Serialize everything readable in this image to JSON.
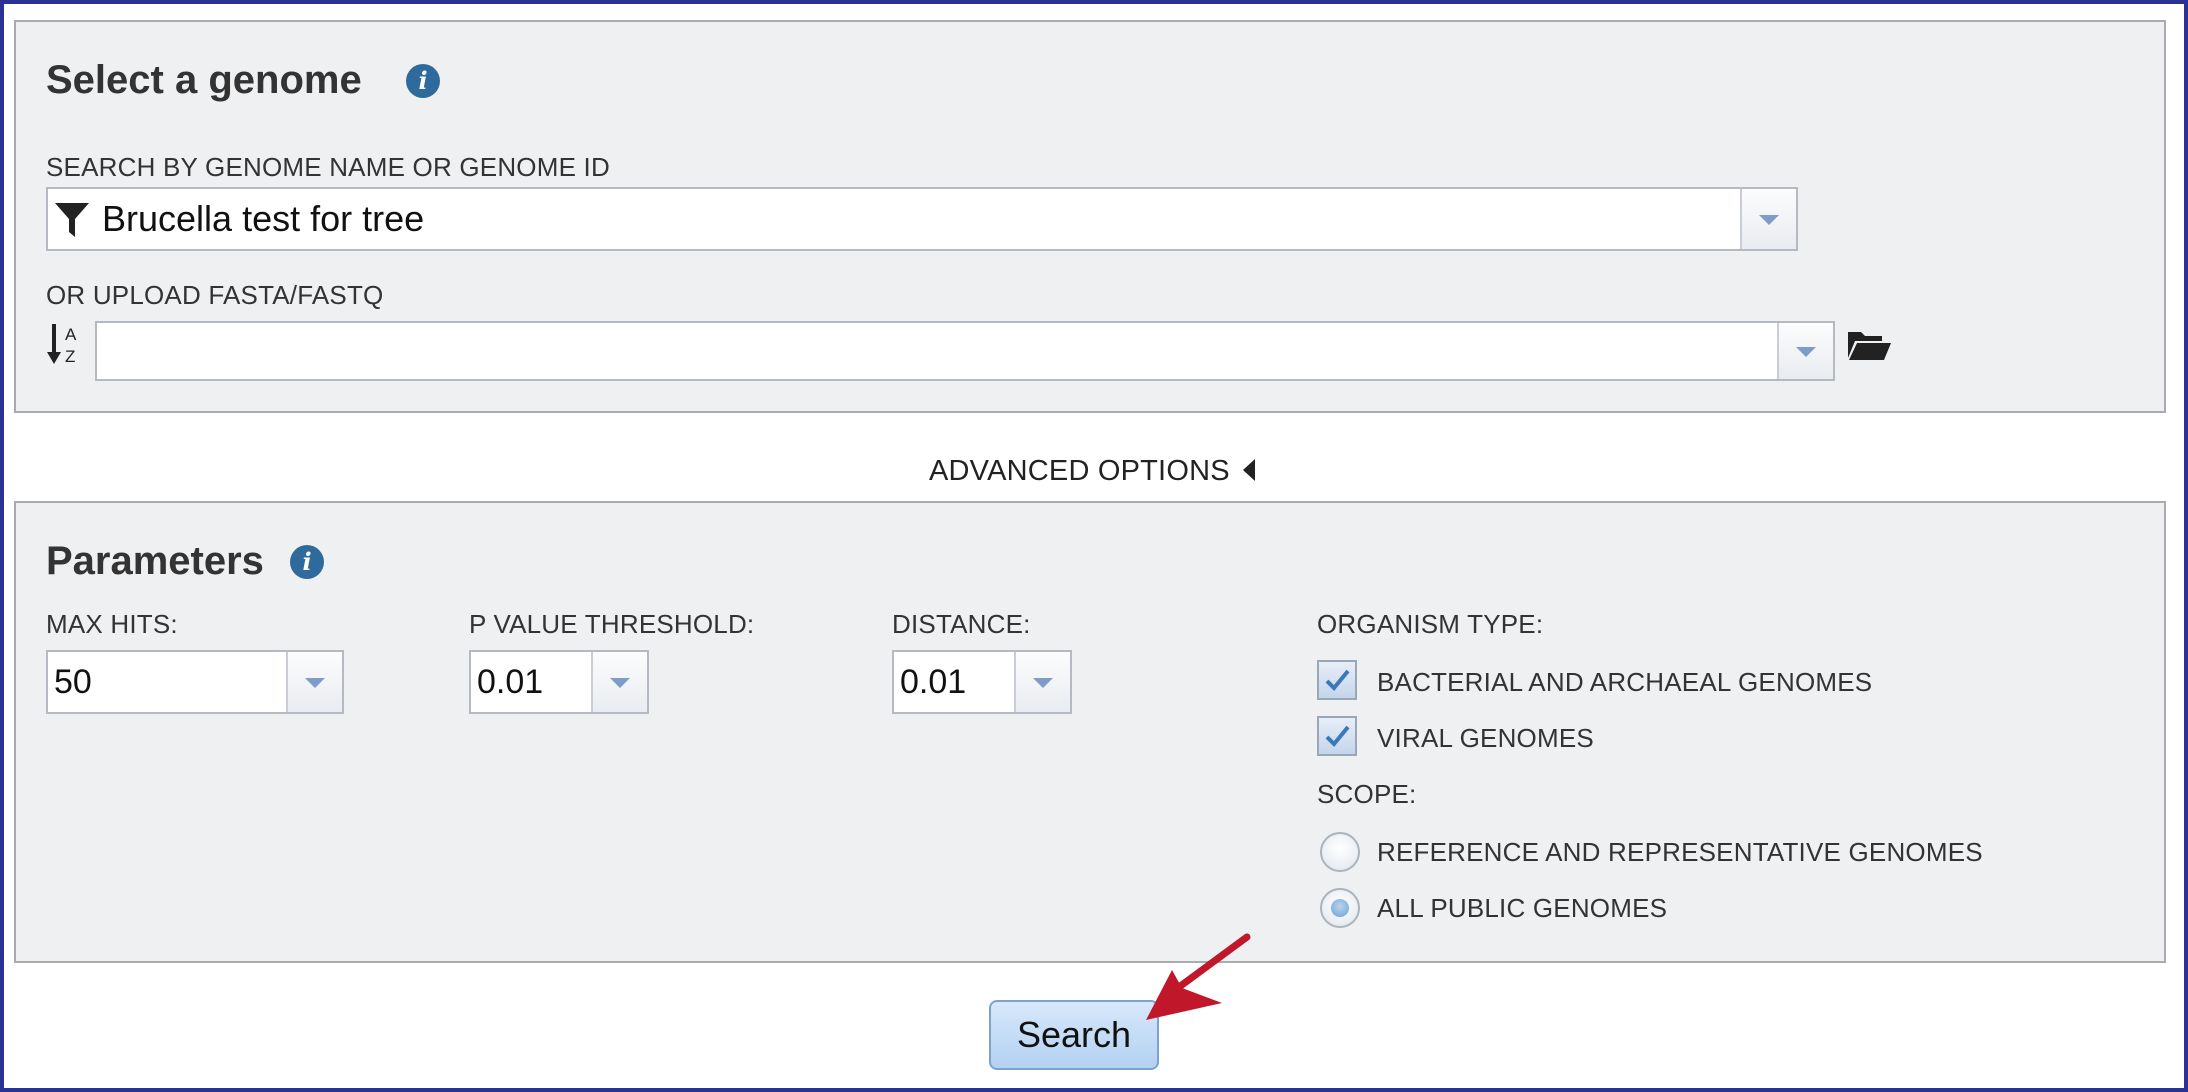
{
  "select_genome": {
    "heading": "Select a genome",
    "search_label": "SEARCH BY GENOME NAME OR GENOME ID",
    "search_value": "Brucella test for tree",
    "upload_label": "OR UPLOAD FASTA/FASTQ",
    "upload_value": ""
  },
  "advanced_options": {
    "label": "ADVANCED OPTIONS"
  },
  "parameters": {
    "heading": "Parameters",
    "max_hits": {
      "label": "MAX HITS:",
      "value": "50"
    },
    "p_value": {
      "label": "P VALUE THRESHOLD:",
      "value": "0.01"
    },
    "distance": {
      "label": "DISTANCE:",
      "value": "0.01"
    },
    "organism_type": {
      "label": "ORGANISM TYPE:",
      "options": [
        {
          "label": "BACTERIAL AND ARCHAEAL GENOMES",
          "checked": true
        },
        {
          "label": "VIRAL GENOMES",
          "checked": true
        }
      ]
    },
    "scope": {
      "label": "SCOPE:",
      "options": [
        {
          "label": "REFERENCE AND REPRESENTATIVE GENOMES",
          "selected": false
        },
        {
          "label": "ALL PUBLIC GENOMES",
          "selected": true
        }
      ]
    }
  },
  "search_button": {
    "label": "Search"
  },
  "icons": {
    "info": "info-icon",
    "filter": "filter-icon",
    "sort": "sort-az-icon",
    "folder": "folder-open-icon",
    "caret": "caret-left-icon",
    "arrow": "annotation-arrow-icon"
  },
  "colors": {
    "frame": "#2b3296",
    "panel_bg": "#eff0f2",
    "info": "#2f6a9c",
    "button": "#b3d1f1",
    "arrow": "#c0182a"
  }
}
